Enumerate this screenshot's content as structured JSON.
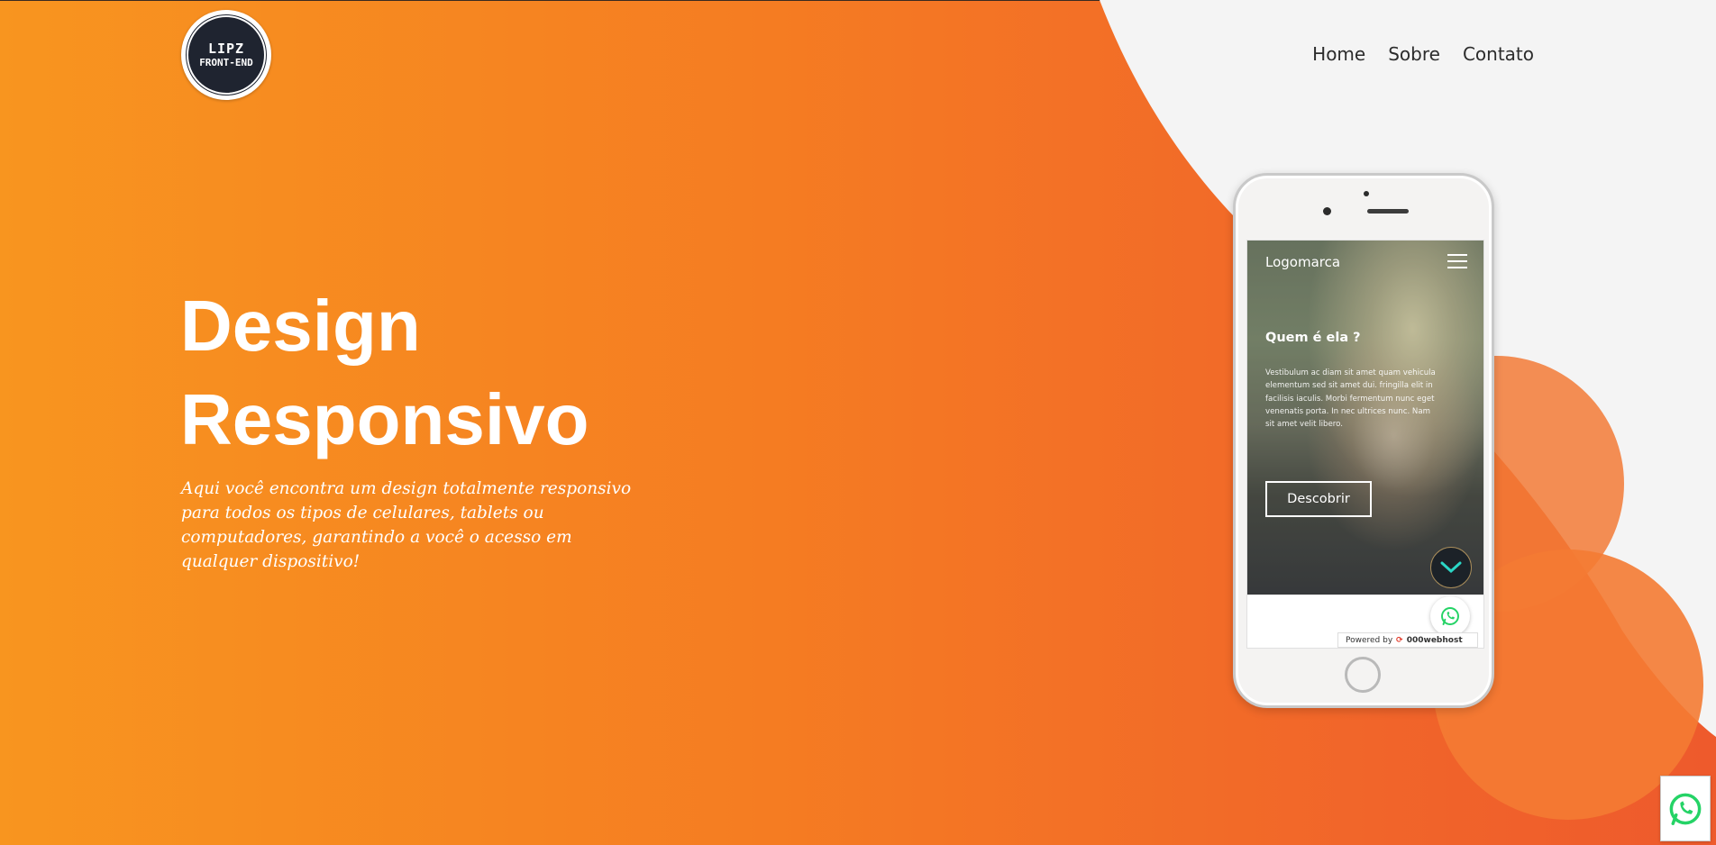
{
  "brand": {
    "logo_line1": "LIPZ",
    "logo_line2": "FRONT-END"
  },
  "nav": {
    "items": [
      "Home",
      "Sobre",
      "Contato"
    ]
  },
  "hero": {
    "title_line1": "Design",
    "title_line2": "Responsivo",
    "subtitle": "Aqui você encontra um design totalmente responsivo para todos os tipos de celulares, tablets ou computadores, garantindo a você o acesso em qualquer dispositivo!"
  },
  "phone_mockup": {
    "logo_text": "Logomarca",
    "heading": "Quem é ela ?",
    "body_text": "Vestibulum ac diam sit amet quam vehicula elementum sed sit amet dui. fringilla elit in facilisis iaculis. Morbi fermentum nunc eget venenatis porta. In nec ultrices nunc. Nam sit amet velit libero.",
    "button_label": "Descobrir",
    "powered_by_label": "Powered by",
    "powered_by_brand": "000webhost"
  },
  "icons": {
    "whatsapp": "whatsapp-icon",
    "menu": "hamburger-menu-icon",
    "scroll_down": "chevron-down-icon"
  },
  "colors": {
    "gradient_start": "#f8951f",
    "gradient_end": "#ee5a2c",
    "light_panel": "#f4f4f4",
    "nav_text": "#2c2c2c",
    "whatsapp_green": "#25d366"
  }
}
